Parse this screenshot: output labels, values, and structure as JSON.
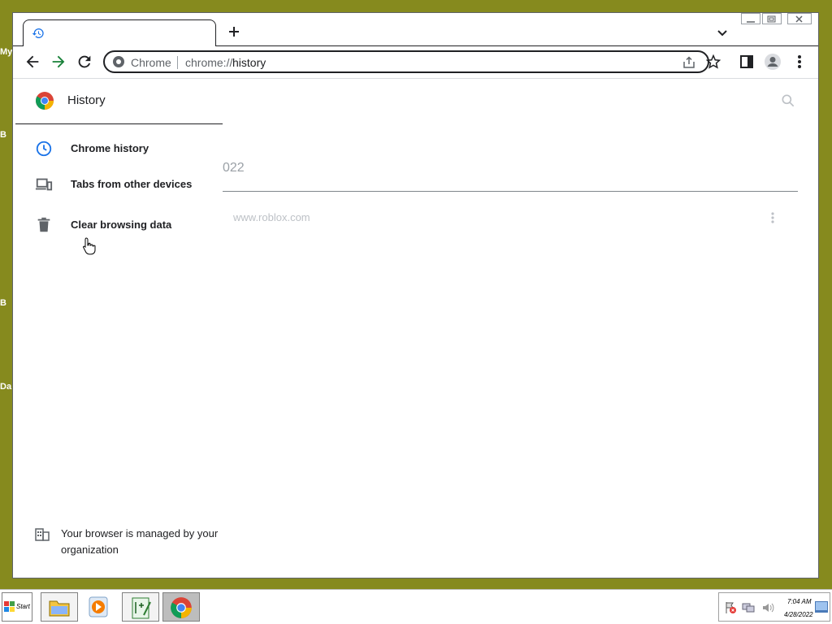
{
  "desktop": {
    "labels": [
      "My",
      "B",
      "B",
      "Da"
    ]
  },
  "browser": {
    "tab": {
      "title": "",
      "icon": "history-icon"
    },
    "address": {
      "site_chip": "Chrome",
      "url_prefix": "chrome://",
      "url_path": "history"
    },
    "window_controls": [
      "minimize",
      "maximize",
      "close"
    ]
  },
  "drawer": {
    "title": "History",
    "items": [
      {
        "label": "Chrome history",
        "icon": "clock-icon"
      },
      {
        "label": "Tabs from other devices",
        "icon": "devices-icon"
      },
      {
        "label": "Clear browsing data",
        "icon": "trash-icon"
      }
    ],
    "managed_notice": "Your browser is managed by your organization"
  },
  "main": {
    "date_heading_partial": "022",
    "entries": [
      {
        "domain": "www.roblox.com"
      }
    ]
  },
  "taskbar": {
    "start_label": "Start",
    "clock_time": "7:04 AM",
    "clock_date": "4/28/2022"
  },
  "colors": {
    "desktop": "#868a1e",
    "accent_blue": "#1a73e8",
    "forward_green": "#188038"
  }
}
